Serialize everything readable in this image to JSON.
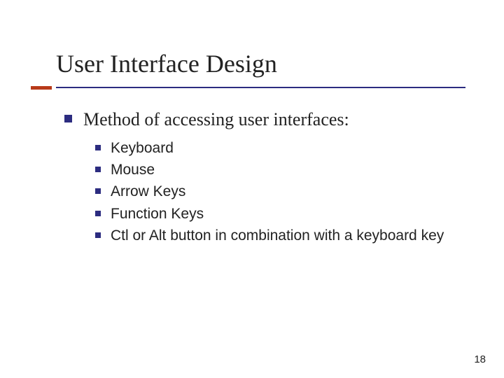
{
  "title": "User Interface Design",
  "heading": "Method of accessing user interfaces:",
  "items": [
    "Keyboard",
    "Mouse",
    "Arrow Keys",
    "Function Keys",
    "Ctl or Alt button in combination with a keyboard key"
  ],
  "page_number": "18"
}
